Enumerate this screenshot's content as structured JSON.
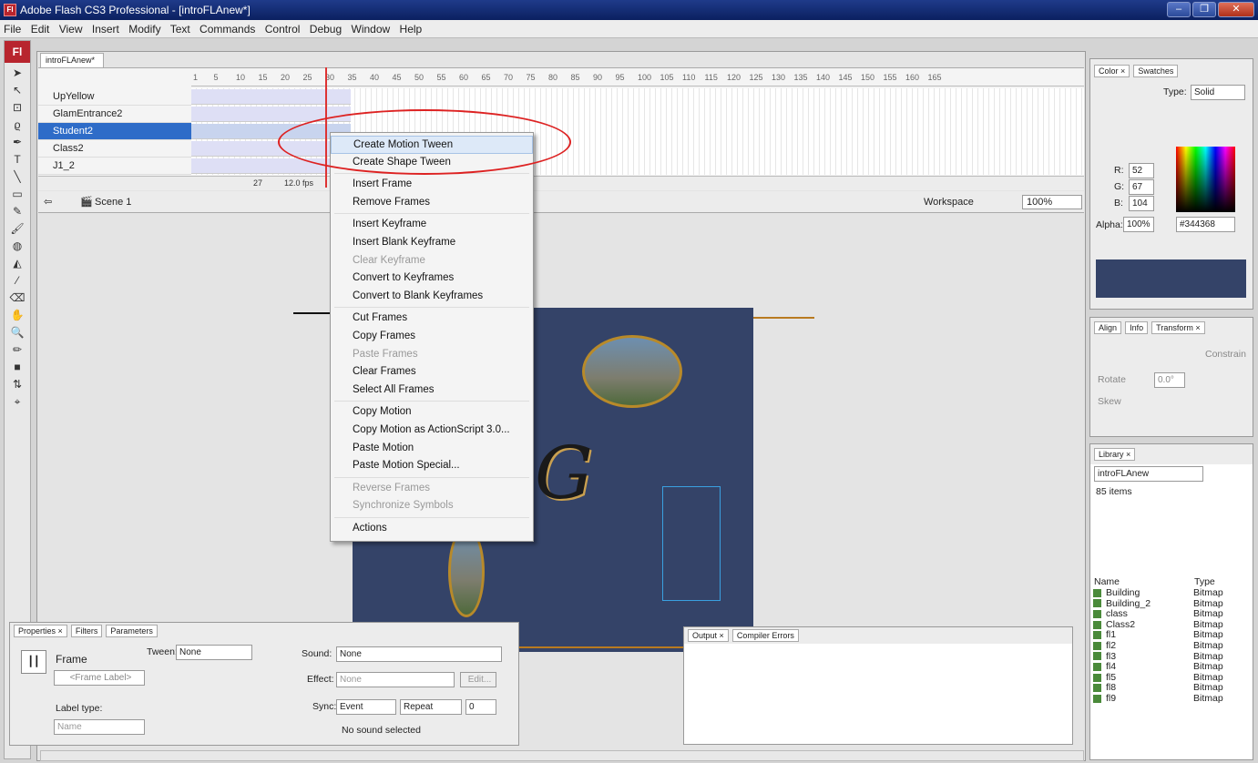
{
  "window": {
    "title": "Adobe Flash CS3 Professional - [introFLAnew*]",
    "logo": "Fl",
    "controls": [
      "–",
      "❐",
      "✕"
    ]
  },
  "menu": [
    "File",
    "Edit",
    "View",
    "Insert",
    "Modify",
    "Text",
    "Commands",
    "Control",
    "Debug",
    "Window",
    "Help"
  ],
  "tools": {
    "logo": "Fl",
    "icons": [
      "arrow-icon",
      "subselect-icon",
      "free-transform-icon",
      "lasso-icon",
      "pen-icon",
      "text-icon",
      "line-icon",
      "rectangle-icon",
      "pencil-icon",
      "brush-icon",
      "ink-bottle-icon",
      "paint-bucket-icon",
      "eyedropper-icon",
      "eraser-icon",
      "hand-icon",
      "zoom-icon",
      "stroke-color-icon",
      "fill-color-icon"
    ]
  },
  "document": {
    "tab": "introFLAnew*",
    "timeline": {
      "ruler": [
        "1",
        "5",
        "10",
        "15",
        "20",
        "25",
        "30",
        "35",
        "40",
        "45",
        "50",
        "55",
        "60",
        "65",
        "70",
        "75",
        "80",
        "85",
        "90",
        "95",
        "100",
        "105",
        "110",
        "115",
        "120",
        "125",
        "130",
        "135",
        "140",
        "145",
        "150",
        "155",
        "160",
        "165"
      ],
      "layers": [
        "UpYellow",
        "GlamEntrance2",
        "Student2",
        "Class2",
        "J1_2"
      ],
      "selected_layer": "Student2",
      "current_frame": "27",
      "fps": "12.0 fps"
    },
    "scene": "Scene 1",
    "workspace_label": "Workspace",
    "zoom": "100%"
  },
  "context_menu": {
    "items": [
      {
        "label": "Create Motion Tween",
        "disabled": false,
        "highlight": true
      },
      {
        "label": "Create Shape Tween",
        "disabled": false
      },
      {
        "sep": true
      },
      {
        "label": "Insert Frame",
        "disabled": false
      },
      {
        "label": "Remove Frames",
        "disabled": false
      },
      {
        "sep": true
      },
      {
        "label": "Insert Keyframe",
        "disabled": false
      },
      {
        "label": "Insert Blank Keyframe",
        "disabled": false
      },
      {
        "label": "Clear Keyframe",
        "disabled": true
      },
      {
        "label": "Convert to Keyframes",
        "disabled": false
      },
      {
        "label": "Convert to Blank Keyframes",
        "disabled": false
      },
      {
        "sep": true
      },
      {
        "label": "Cut Frames",
        "disabled": false
      },
      {
        "label": "Copy Frames",
        "disabled": false
      },
      {
        "label": "Paste Frames",
        "disabled": true
      },
      {
        "label": "Clear Frames",
        "disabled": false
      },
      {
        "label": "Select All Frames",
        "disabled": false
      },
      {
        "sep": true
      },
      {
        "label": "Copy Motion",
        "disabled": false
      },
      {
        "label": "Copy Motion as ActionScript 3.0...",
        "disabled": false
      },
      {
        "label": "Paste Motion",
        "disabled": false
      },
      {
        "label": "Paste Motion Special...",
        "disabled": false
      },
      {
        "sep": true
      },
      {
        "label": "Reverse Frames",
        "disabled": true
      },
      {
        "label": "Synchronize Symbols",
        "disabled": true
      },
      {
        "sep": true
      },
      {
        "label": "Actions",
        "disabled": false
      }
    ]
  },
  "properties": {
    "tabs": [
      "Properties ×",
      "Filters",
      "Parameters"
    ],
    "frame_label": "Frame",
    "frame_placeholder": "<Frame Label>",
    "tween_label": "Tween:",
    "tween_value": "None",
    "sound_label": "Sound:",
    "sound_value": "None",
    "effect_label": "Effect:",
    "effect_value": "None",
    "edit_button": "Edit...",
    "sync_label": "Sync:",
    "sync_value": "Event",
    "repeat_value": "Repeat",
    "repeat_count": "0",
    "no_sound": "No sound selected",
    "label_type_label": "Label type:",
    "label_type_value": "Name"
  },
  "output": {
    "tabs": [
      "Output ×",
      "Compiler Errors"
    ]
  },
  "color_panel": {
    "tabs": [
      "Color ×",
      "Swatches"
    ],
    "type_label": "Type:",
    "type_value": "Solid",
    "r_label": "R:",
    "r": "52",
    "g_label": "G:",
    "g": "67",
    "b_label": "B:",
    "b": "104",
    "alpha_label": "Alpha:",
    "alpha": "100%",
    "hex": "#344368",
    "swatch_color": "#344368"
  },
  "transform_panel": {
    "tabs": [
      "Align",
      "Info",
      "Transform ×"
    ],
    "constrain": "Constrain",
    "rotate": "Rotate",
    "rotate_value": "0.0°",
    "skew": "Skew"
  },
  "library": {
    "tab": "Library ×",
    "file": "introFLAnew",
    "count": "85 items",
    "col_name": "Name",
    "col_type": "Type",
    "items": [
      {
        "name": "Building",
        "type": "Bitmap"
      },
      {
        "name": "Building_2",
        "type": "Bitmap"
      },
      {
        "name": "class",
        "type": "Bitmap"
      },
      {
        "name": "Class2",
        "type": "Bitmap"
      },
      {
        "name": "fl1",
        "type": "Bitmap"
      },
      {
        "name": "fl2",
        "type": "Bitmap"
      },
      {
        "name": "fl3",
        "type": "Bitmap"
      },
      {
        "name": "fl4",
        "type": "Bitmap"
      },
      {
        "name": "fl5",
        "type": "Bitmap"
      },
      {
        "name": "fl8",
        "type": "Bitmap"
      },
      {
        "name": "fl9",
        "type": "Bitmap"
      }
    ]
  }
}
